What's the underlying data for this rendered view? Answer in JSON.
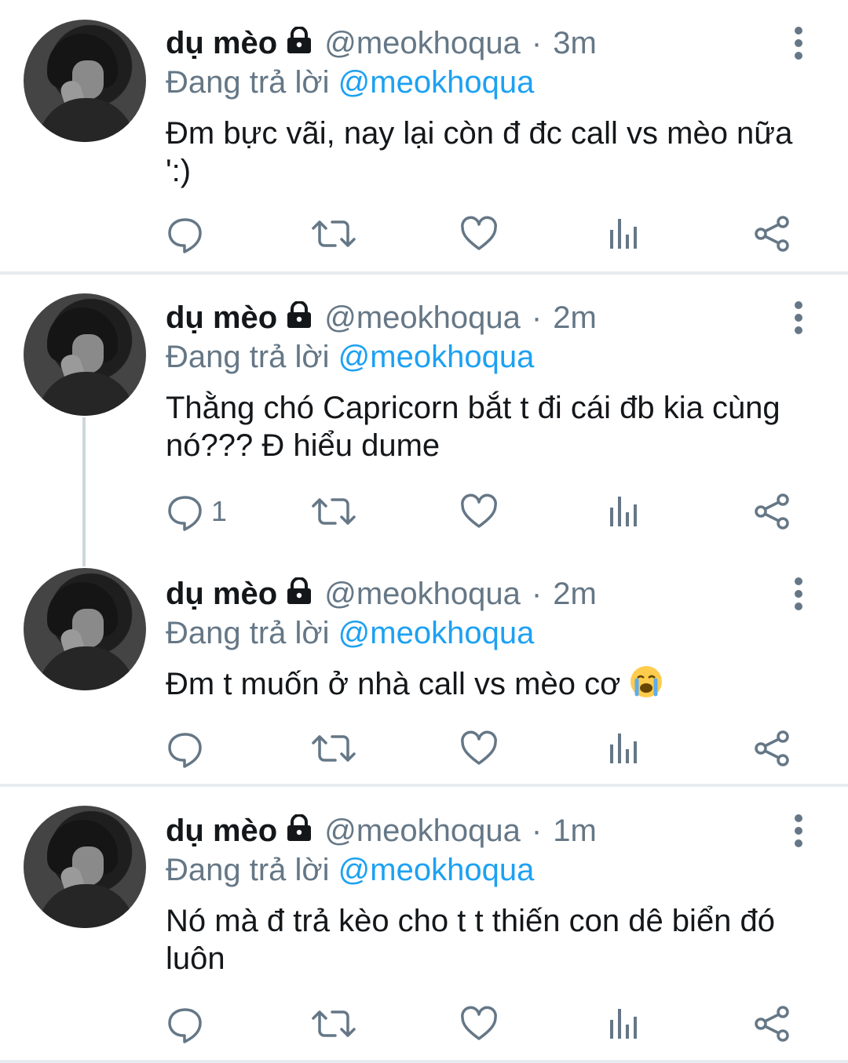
{
  "colors": {
    "primary_text": "#14171a",
    "secondary_text": "#657786",
    "accent": "#1da1f2",
    "divider": "#e6ecf0",
    "thread_line": "#ccd6dd"
  },
  "tweets": [
    {
      "author": "dụ mèo",
      "handle": "@meokhoqua",
      "dot": "·",
      "time": "3m",
      "reply_prefix": "Đang trả lời",
      "reply_to": "@meokhoqua",
      "text": "Đm bực vãi, nay lại còn đ đc call vs mèo nữa ':)",
      "reply_count": ""
    },
    {
      "author": "dụ mèo",
      "handle": "@meokhoqua",
      "dot": "·",
      "time": "2m",
      "reply_prefix": "Đang trả lời",
      "reply_to": "@meokhoqua",
      "text": "Thằng chó Capricorn bắt t đi cái đb kia cùng nó??? Đ hiểu dume",
      "reply_count": "1"
    },
    {
      "author": "dụ mèo",
      "handle": "@meokhoqua",
      "dot": "·",
      "time": "2m",
      "reply_prefix": "Đang trả lời",
      "reply_to": "@meokhoqua",
      "text": "Đm t muốn ở nhà call vs mèo cơ",
      "emoji": "crying-face",
      "reply_count": ""
    },
    {
      "author": "dụ mèo",
      "handle": "@meokhoqua",
      "dot": "·",
      "time": "1m",
      "reply_prefix": "Đang trả lời",
      "reply_to": "@meokhoqua",
      "text": "Nó mà đ trả kèo cho t t thiến con dê biển đó luôn",
      "reply_count": ""
    }
  ],
  "icons": {
    "lock": "lock-icon",
    "more": "more-vertical-icon",
    "reply": "reply-icon",
    "retweet": "retweet-icon",
    "like": "heart-icon",
    "analytics": "analytics-icon",
    "share": "share-icon"
  }
}
